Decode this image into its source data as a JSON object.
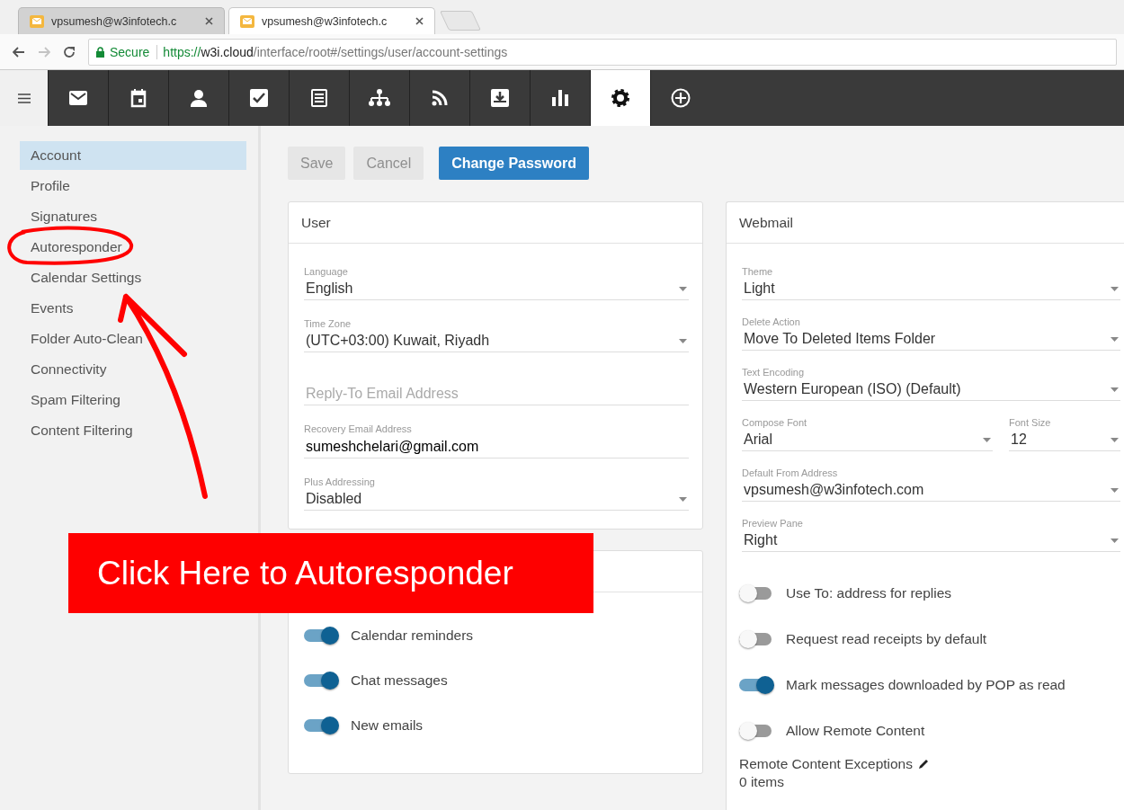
{
  "browser": {
    "tabs": [
      {
        "title": "vpsumesh@w3infotech.c",
        "selected": false
      },
      {
        "title": "vpsumesh@w3infotech.c",
        "selected": true
      }
    ],
    "secure_label": "Secure",
    "url": "https://w3i.cloud/interface/root#/settings/user/account-settings"
  },
  "toolbar": {
    "items": [
      {
        "selected": false
      },
      {
        "selected": false
      },
      {
        "selected": false
      },
      {
        "selected": false
      },
      {
        "selected": false
      },
      {
        "selected": false
      },
      {
        "selected": false
      },
      {
        "selected": false
      },
      {
        "selected": false
      },
      {
        "selected": true
      },
      {
        "selected": false
      }
    ]
  },
  "sidebar": {
    "items": [
      {
        "label": "Account",
        "selected": true
      },
      {
        "label": "Profile",
        "selected": false
      },
      {
        "label": "Signatures",
        "selected": false
      },
      {
        "label": "Autoresponder",
        "selected": false
      },
      {
        "label": "Calendar Settings",
        "selected": false
      },
      {
        "label": "Events",
        "selected": false
      },
      {
        "label": "Folder Auto-Clean",
        "selected": false
      },
      {
        "label": "Connectivity",
        "selected": false
      },
      {
        "label": "Spam Filtering",
        "selected": false
      },
      {
        "label": "Content Filtering",
        "selected": false
      }
    ]
  },
  "buttons": [
    {
      "label": "Save",
      "kind": "default",
      "disabled": true
    },
    {
      "label": "Cancel",
      "kind": "default",
      "disabled": true
    },
    {
      "label": "Change Password",
      "kind": "primary",
      "disabled": false
    }
  ],
  "user_card": {
    "title": "User",
    "fields": [
      {
        "kind": "select",
        "label": "Language",
        "value": "English"
      },
      {
        "kind": "select",
        "label": "Time Zone",
        "value": "(UTC+03:00) Kuwait, Riyadh"
      },
      {
        "kind": "input",
        "placeholder": "Reply-To Email Address"
      },
      {
        "kind": "text",
        "label": "Recovery Email Address",
        "value": "sumeshchelari@gmail.com"
      },
      {
        "kind": "select",
        "label": "Plus Addressing",
        "value": "Disabled"
      }
    ]
  },
  "notifications_card": {
    "toggles": [
      {
        "label": "Calendar reminders",
        "on": true
      },
      {
        "label": "Chat messages",
        "on": true
      },
      {
        "label": "New emails",
        "on": true
      }
    ]
  },
  "webmail_card": {
    "title": "Webmail",
    "rows": [
      {
        "fields": [
          {
            "kind": "select",
            "label": "Theme",
            "value": "Light"
          }
        ]
      },
      {
        "fields": [
          {
            "kind": "select",
            "label": "Delete Action",
            "value": "Move To Deleted Items Folder"
          }
        ]
      },
      {
        "fields": [
          {
            "kind": "select",
            "label": "Text Encoding",
            "value": "Western European (ISO) (Default)"
          }
        ]
      },
      {
        "fields": [
          {
            "kind": "select",
            "label": "Compose Font",
            "value": "Arial"
          },
          {
            "kind": "select",
            "label": "Font Size",
            "value": "12"
          }
        ]
      },
      {
        "fields": [
          {
            "kind": "select",
            "label": "Default From Address",
            "value": "vpsumesh@w3infotech.com"
          }
        ]
      },
      {
        "fields": [
          {
            "kind": "select",
            "label": "Preview Pane",
            "value": "Right"
          }
        ]
      }
    ],
    "toggles": [
      {
        "label": "Use To: address for replies",
        "on": false
      },
      {
        "label": "Request read receipts by default",
        "on": false
      },
      {
        "label": "Mark messages downloaded by POP as read",
        "on": true
      },
      {
        "label": "Allow Remote Content",
        "on": false
      }
    ],
    "exceptions_label": "Remote Content Exceptions",
    "exceptions_count": "0 items"
  },
  "annotation": {
    "callout": "Click Here to Autoresponder"
  }
}
